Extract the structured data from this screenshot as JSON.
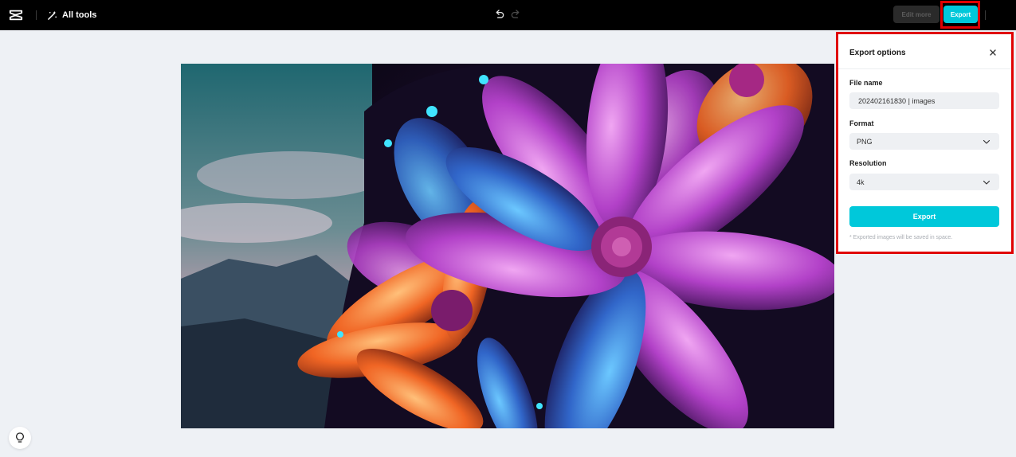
{
  "topbar": {
    "all_tools_label": "All tools",
    "edit_more_label": "Edit more",
    "export_label": "Export"
  },
  "export_panel": {
    "title": "Export options",
    "file_name": {
      "label": "File name",
      "value": "202402161830 | images"
    },
    "format": {
      "label": "Format",
      "value": "PNG"
    },
    "resolution": {
      "label": "Resolution",
      "value": "4k"
    },
    "export_button_label": "Export",
    "note": "* Exported images will be saved in space."
  },
  "colors": {
    "accent": "#00c8da",
    "highlight_border": "#e00000",
    "topbar_bg": "#000000",
    "canvas_bg": "#eef1f5"
  },
  "icons": {
    "logo": "capcut-logo-icon",
    "all_tools": "magic-wand-icon",
    "undo": "undo-icon",
    "redo": "redo-icon",
    "close": "close-icon",
    "dropdown": "chevron-down-icon",
    "help": "lightbulb-icon"
  }
}
